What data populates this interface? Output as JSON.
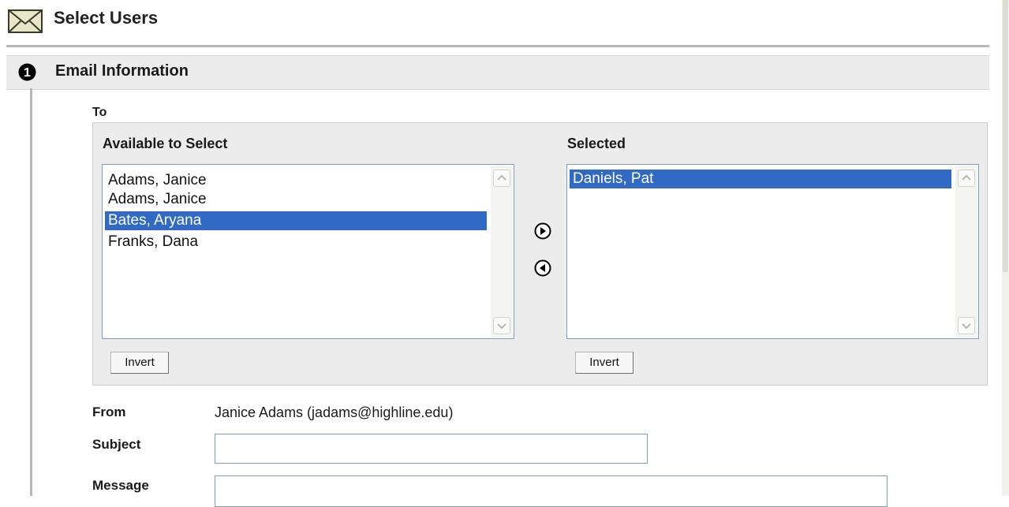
{
  "page": {
    "title": "Select Users",
    "title_icon": "envelope-icon"
  },
  "section": {
    "step_number": "1",
    "title": "Email Information"
  },
  "to": {
    "label": "To",
    "available": {
      "label": "Available to Select",
      "items": [
        "Adams, Janice",
        "Adams, Janice",
        "Bates, Aryana",
        "Franks, Dana"
      ],
      "selected_index": 2,
      "invert_label": "Invert"
    },
    "selected": {
      "label": "Selected",
      "items": [
        "Daniels, Pat"
      ],
      "selected_index": 0,
      "invert_label": "Invert"
    },
    "add_icon": "arrow-right-circle-icon",
    "remove_icon": "arrow-left-circle-icon"
  },
  "from": {
    "label": "From",
    "value": "Janice Adams (jadams@highline.edu)"
  },
  "subject": {
    "label": "Subject",
    "value": ""
  },
  "message": {
    "label": "Message",
    "value": ""
  },
  "colors": {
    "selection": "#316ac5",
    "panel_bg": "#ececec",
    "section_bg": "#ececec",
    "input_border": "#7f9db9"
  }
}
